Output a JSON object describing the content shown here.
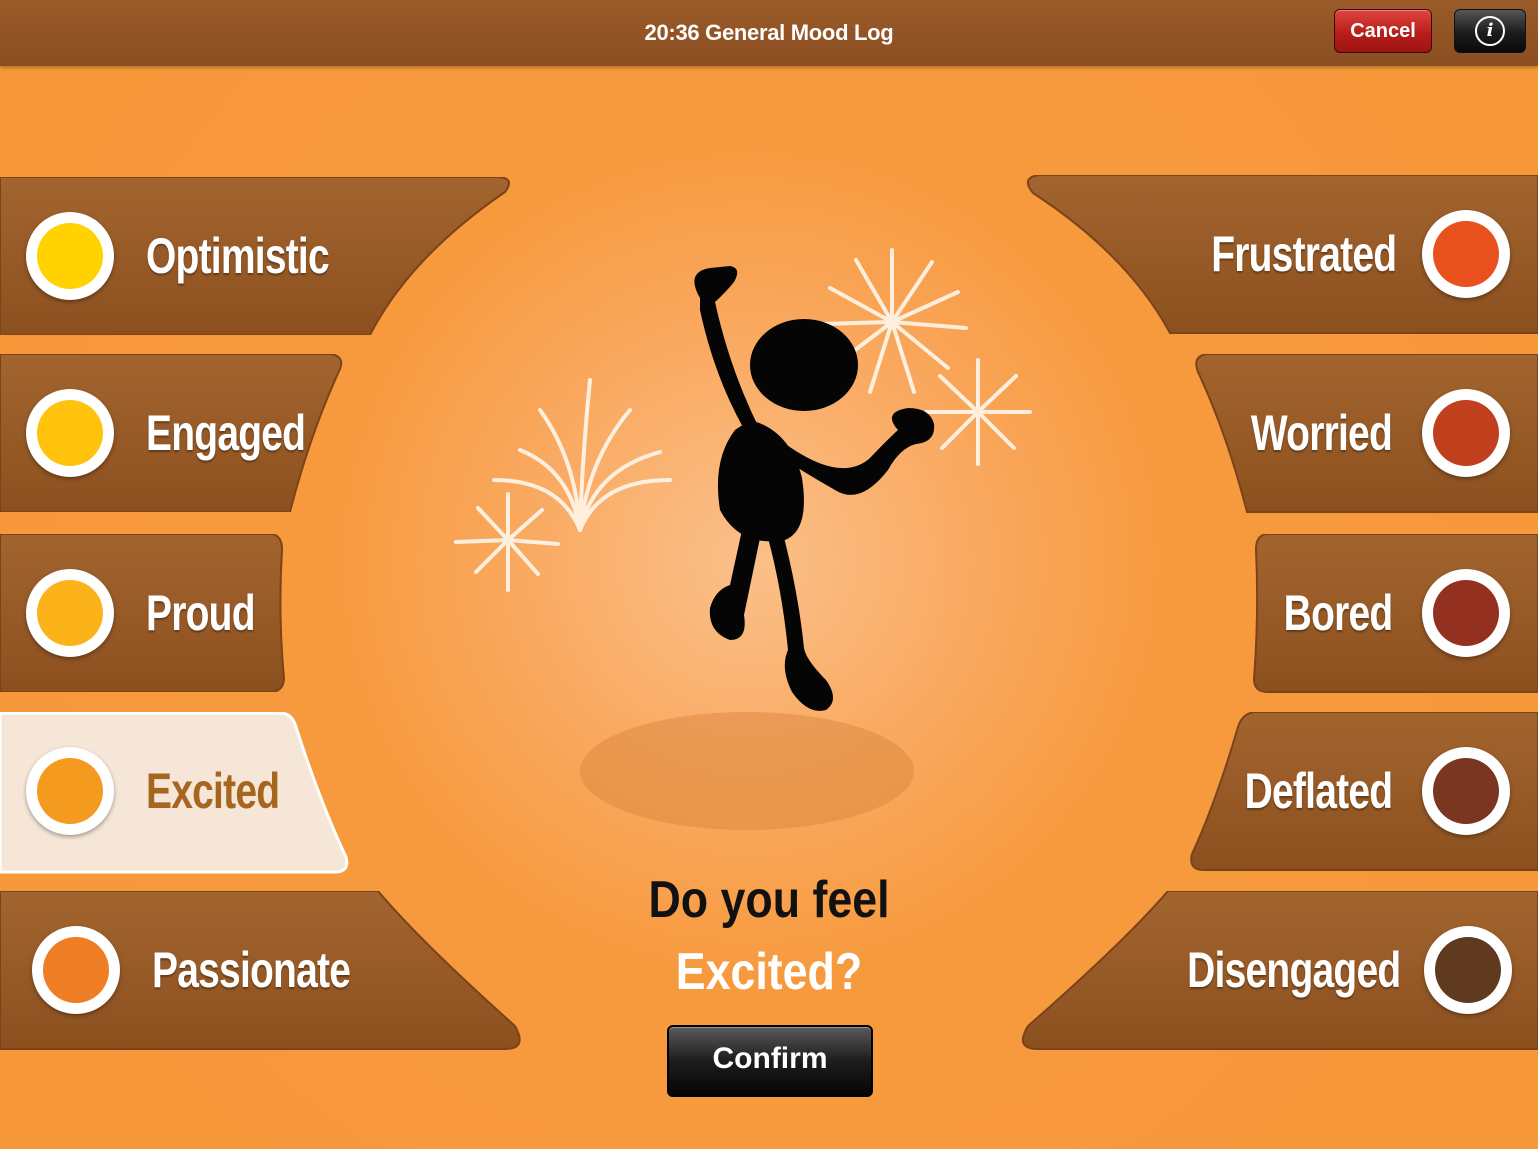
{
  "header": {
    "title": "20:36 General Mood Log",
    "cancel_label": "Cancel",
    "info_label": "i"
  },
  "moods_left": [
    {
      "label": "Optimistic",
      "color": "#ffd200"
    },
    {
      "label": "Engaged",
      "color": "#ffc30d"
    },
    {
      "label": "Proud",
      "color": "#fbb319"
    },
    {
      "label": "Excited",
      "color": "#f49b1f",
      "selected": true
    },
    {
      "label": "Passionate",
      "color": "#ee7e25"
    }
  ],
  "moods_right": [
    {
      "label": "Frustrated",
      "color": "#e8511d"
    },
    {
      "label": "Worried",
      "color": "#c0401d"
    },
    {
      "label": "Bored",
      "color": "#93301f"
    },
    {
      "label": "Deflated",
      "color": "#7b3621"
    },
    {
      "label": "Disengaged",
      "color": "#5f3a1f"
    }
  ],
  "question": {
    "line1": "Do you feel",
    "line2": "Excited?"
  },
  "confirm_label": "Confirm",
  "colors": {
    "background": "#f7983b",
    "plank": "#9a5b28",
    "selected_plank": "#f6e6d7",
    "header": "#8b4f22"
  }
}
